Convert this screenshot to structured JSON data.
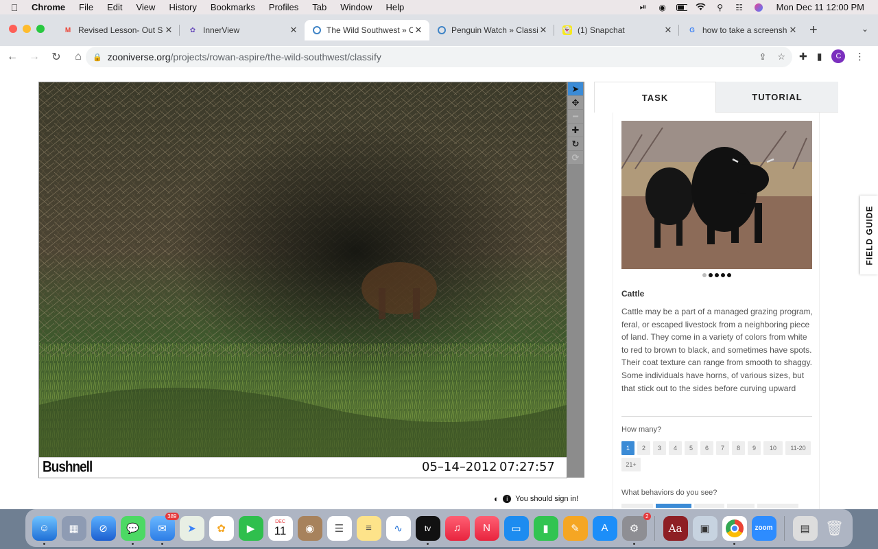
{
  "menubar": {
    "app": "Chrome",
    "items": [
      "File",
      "Edit",
      "View",
      "History",
      "Bookmarks",
      "Profiles",
      "Tab",
      "Window",
      "Help"
    ],
    "clock": "Mon Dec 11  12:00 PM"
  },
  "tabs": [
    {
      "title": "Revised Lesson- Out Sic",
      "icon": "gmail-icon",
      "color": "#ea4335"
    },
    {
      "title": "InnerView",
      "icon": "innerview-icon",
      "color": "#6b4fbb"
    },
    {
      "title": "The Wild Southwest » C",
      "icon": "zooniverse-icon",
      "color": "#3f84c6",
      "active": true
    },
    {
      "title": "Penguin Watch » Classif",
      "icon": "zooniverse-icon",
      "color": "#3f84c6"
    },
    {
      "title": "(1) Snapchat",
      "icon": "snapchat-icon",
      "color": "#f7e91c"
    },
    {
      "title": "how to take a screenshi",
      "icon": "google-icon",
      "color": "#4285f4"
    }
  ],
  "address": {
    "host": "zooniverse.org",
    "path": "/projects/rowan-aspire/the-wild-southwest/classify"
  },
  "profile_initial": "C",
  "viewer": {
    "brand": "Bushnell",
    "date": "05–14–2012",
    "time": "07:27:57",
    "sign_in_notice": "You should sign in!"
  },
  "panel": {
    "tab_task": "TASK",
    "tab_tutorial": "TUTORIAL",
    "species_name": "Cattle",
    "species_description": "Cattle may be a part of a managed grazing program, feral, or escaped livestock from a neighboring piece of land. They come in a variety of colors from white to red to brown to black, and sometimes have spots. Their coat texture can range from smooth to shaggy. Some individuals have horns, of various sizes, but that stick out to the sides before curving upward",
    "how_many_label": "How many?",
    "how_many_options": [
      "1",
      "2",
      "3",
      "4",
      "5",
      "6",
      "7",
      "8",
      "9",
      "10",
      "11-20",
      "21+"
    ],
    "how_many_selected": "1",
    "behaviors_label": "What behaviors do you see?",
    "field_guide": "FIELD GUIDE",
    "carousel_index": 0,
    "carousel_count": 5
  },
  "dock": {
    "mail_badge": "389",
    "calendar_month": "DEC",
    "calendar_day": "11",
    "settings_badge": "2",
    "zoom_label": "zoom",
    "dictionary_label": "Aa",
    "tv_label": "tv"
  }
}
